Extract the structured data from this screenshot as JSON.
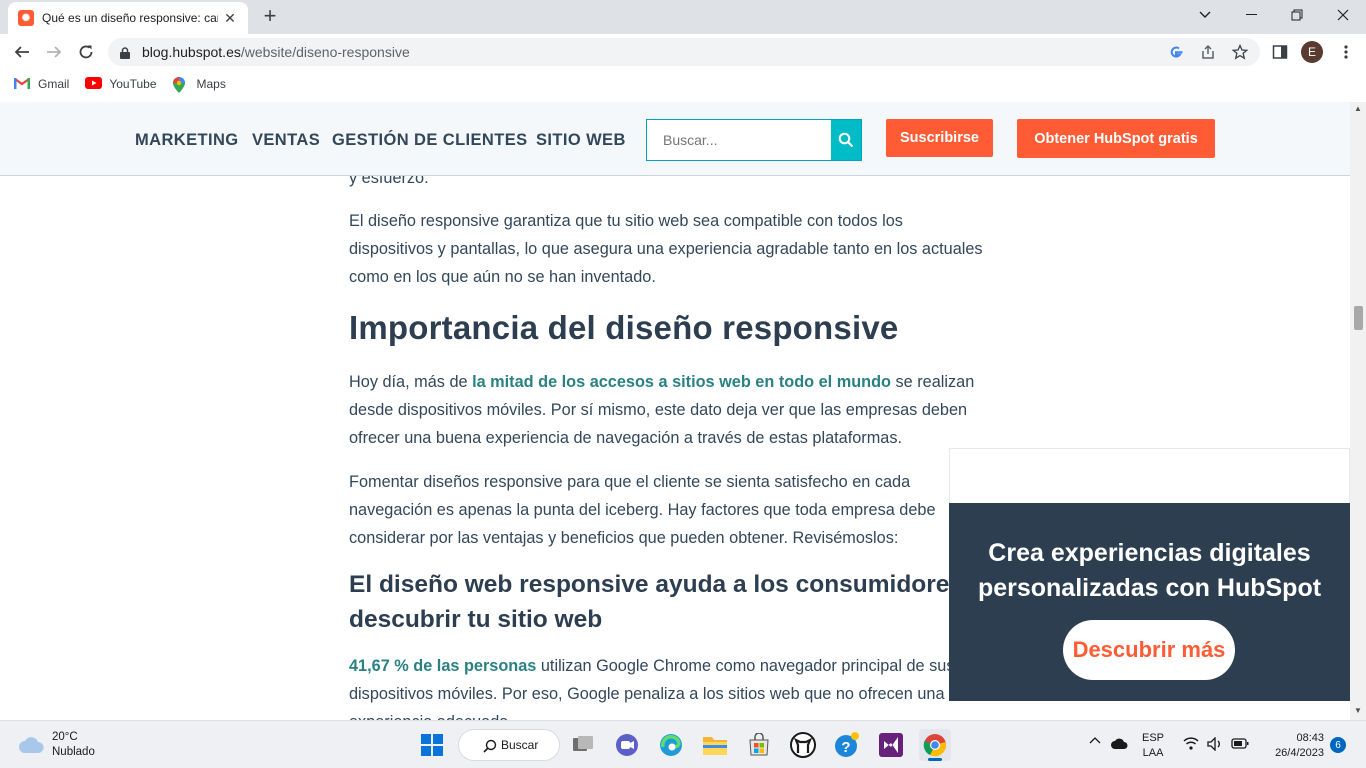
{
  "browser": {
    "tab_title": "Qué es un diseño responsive: car",
    "url_domain": "blog.hubspot.es",
    "url_path": "/website/diseno-responsive",
    "profile_initial": "E",
    "bookmarks": [
      {
        "label": "Gmail",
        "icon": "gmail-icon"
      },
      {
        "label": "YouTube",
        "icon": "youtube-icon"
      },
      {
        "label": "Maps",
        "icon": "maps-icon"
      }
    ]
  },
  "site_header": {
    "nav": [
      "MARKETING",
      "VENTAS",
      "GESTIÓN DE CLIENTES",
      "SITIO WEB"
    ],
    "search_placeholder": "Buscar...",
    "subscribe_label": "Suscribirse",
    "get_hubspot_label": "Obtener HubSpot gratis",
    "accent_color": "#ff5c35",
    "search_color": "#00bcc6"
  },
  "article": {
    "partial_line": "y esfuerzo.",
    "para1": "El diseño responsive garantiza que tu sitio web sea compatible con todos los dispositivos y pantallas, lo que asegura una experiencia agradable tanto en los actuales como en los que aún no se han inventado.",
    "heading1": "Importancia del diseño responsive",
    "para2_before": "Hoy día, más de ",
    "para2_link": "la mitad de los accesos a sitios web en todo el mundo",
    "para2_after": " se realizan desde dispositivos móviles. Por sí mismo, este dato deja ver que las empresas deben ofrecer una buena experiencia de navegación a través de estas plataformas.",
    "para3": "Fomentar diseños responsive para que el cliente se sienta satisfecho en cada navegación es apenas la punta del iceberg. Hay factores que toda empresa debe considerar por las ventajas y beneficios que pueden obtener. Revisémoslos:",
    "heading2": "El diseño web responsive ayuda a los consumidores a descubrir tu sitio web",
    "para4_link": "41,67 % de las personas",
    "para4_after": " utilizan Google Chrome como navegador principal de sus dispositivos móviles. Por eso, Google penaliza a los sitios web que no ofrecen una experiencia adecuada"
  },
  "popup": {
    "title": "Crea experiencias digitales personalizadas con HubSpot",
    "button": "Descubrir más"
  },
  "taskbar": {
    "temperature": "20°C",
    "weather": "Nublado",
    "search_label": "Buscar",
    "lang": "ESP",
    "layout": "LAA",
    "time": "08:43",
    "date": "26/4/2023",
    "notifications": "6"
  }
}
